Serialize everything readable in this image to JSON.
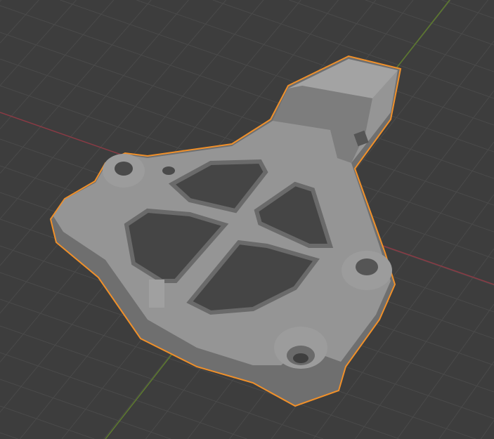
{
  "viewport": {
    "background_color": "#3d3d3d",
    "grid_color": "#4a4a4a",
    "x_axis_color": "#8a3a44",
    "y_axis_color": "#5d7a2e",
    "object_color": "#8e8e8e",
    "object_shade_color": "#6f6f6f",
    "selection_outline_color": "#f0902a"
  }
}
